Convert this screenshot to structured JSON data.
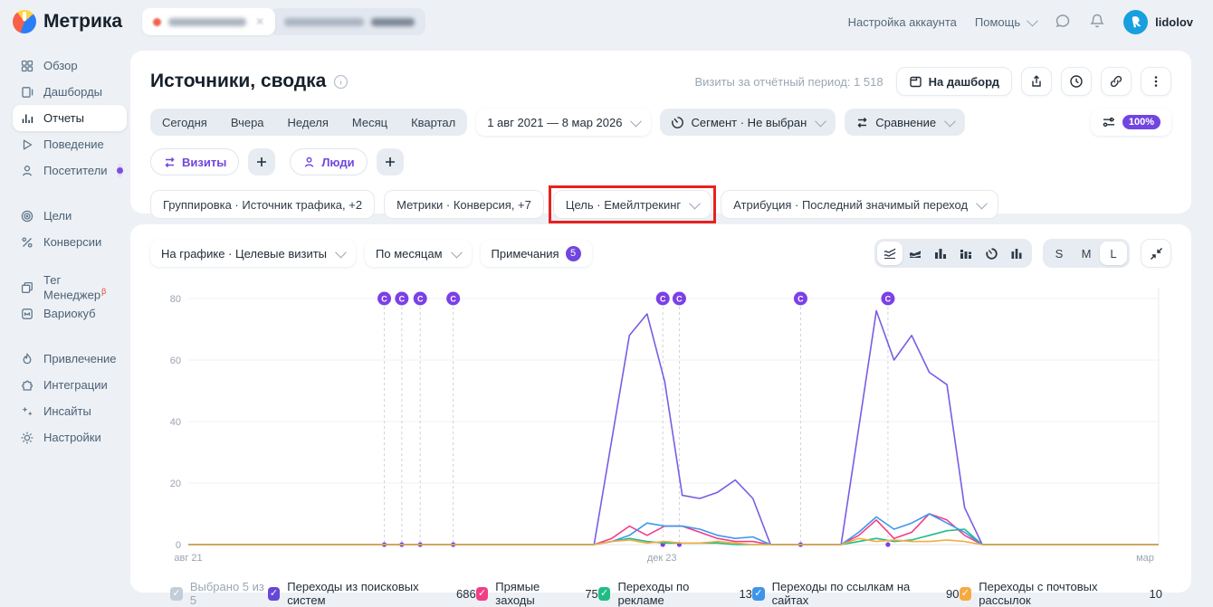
{
  "brand": {
    "name": "Метрика"
  },
  "topbar": {
    "account_settings": "Настройка аккаунта",
    "help": "Помощь",
    "username": "lidolov"
  },
  "sidebar": {
    "items": [
      {
        "label": "Обзор"
      },
      {
        "label": "Дашборды"
      },
      {
        "label": "Отчеты"
      },
      {
        "label": "Поведение"
      },
      {
        "label": "Посетители"
      },
      {
        "label": "Цели"
      },
      {
        "label": "Конверсии"
      },
      {
        "label": "Тег Менеджер",
        "beta": "β"
      },
      {
        "label": "Вариокуб"
      },
      {
        "label": "Привлечение"
      },
      {
        "label": "Интеграции"
      },
      {
        "label": "Инсайты"
      },
      {
        "label": "Настройки"
      }
    ]
  },
  "header": {
    "title": "Источники, сводка",
    "visits_note": "Визиты за отчётный период: 1 518",
    "dashboard_button": "На дашборд"
  },
  "filters": {
    "presets": [
      "Сегодня",
      "Вчера",
      "Неделя",
      "Месяц",
      "Квартал"
    ],
    "date_range": "1 авг 2021 — 8 мар 2026",
    "segment": "Сегмент · Не выбран",
    "compare": "Сравнение",
    "sampling": "100%"
  },
  "metrics_row": {
    "visits": "Визиты",
    "people": "Люди"
  },
  "dropdowns": {
    "grouping": "Группировка · Источник трафика, +2",
    "metrics": "Метрики · Конверсия, +7",
    "goal": "Цель · Емейлтрекинг",
    "attribution": "Атрибуция · Последний значимый переход"
  },
  "chart_controls": {
    "on_chart": "На графике · Целевые визиты",
    "period": "По месяцам",
    "notes": "Примечания",
    "notes_count": "5",
    "sizes": [
      "S",
      "M",
      "L"
    ],
    "active_size": "L"
  },
  "chart_data": {
    "type": "line",
    "title": "Целевые визиты по месяцам",
    "x_unit": "month",
    "x_range": [
      "авг 2021",
      "мар 2026"
    ],
    "xticks": [
      {
        "label": "авг 21",
        "pos": 0.0
      },
      {
        "label": "дек 23",
        "pos": 0.488
      },
      {
        "label": "мар",
        "pos": 0.986
      }
    ],
    "ylim": [
      0,
      80
    ],
    "yticks": [
      0,
      20,
      40,
      60,
      80
    ],
    "grid": true,
    "annotations": {
      "symbol": "C",
      "positions": [
        0.202,
        0.22,
        0.239,
        0.273,
        0.489,
        0.506,
        0.631,
        0.721
      ]
    },
    "series": [
      {
        "name": "Переходы из поисковых систем",
        "color": "#7b5ce2",
        "values": [
          0,
          0,
          0,
          0,
          0,
          0,
          0,
          0,
          0,
          0,
          0,
          0,
          0,
          0,
          0,
          0,
          0,
          0,
          0,
          0,
          0,
          0,
          0,
          0,
          34,
          68,
          75,
          53,
          16,
          15,
          17,
          21,
          15,
          0,
          0,
          0,
          0,
          0,
          38,
          76,
          60,
          68,
          56,
          52,
          12,
          0,
          0,
          0,
          0,
          0,
          0,
          0,
          0,
          0,
          0,
          0
        ]
      },
      {
        "name": "Прямые заходы",
        "color": "#f23d86",
        "values": [
          0,
          0,
          0,
          0,
          0,
          0,
          0,
          0,
          0,
          0,
          0,
          0,
          0,
          0,
          0,
          0,
          0,
          0,
          0,
          0,
          0,
          0,
          0,
          0,
          2,
          6,
          3,
          6,
          6,
          4,
          2,
          1,
          1,
          0,
          0,
          0,
          0,
          0,
          3,
          8,
          2,
          4,
          10,
          8,
          3,
          0,
          0,
          0,
          0,
          0,
          0,
          0,
          0,
          0,
          0,
          0
        ]
      },
      {
        "name": "Переходы по рекламе",
        "color": "#21bd84",
        "values": [
          0,
          0,
          0,
          0,
          0,
          0,
          0,
          0,
          0,
          0,
          0,
          0,
          0,
          0,
          0,
          0,
          0,
          0,
          0,
          0,
          0,
          0,
          0,
          0,
          1,
          2,
          1,
          0.5,
          0.5,
          0.5,
          0.5,
          0,
          0,
          0,
          0,
          0,
          0,
          0,
          1,
          2,
          1,
          1.5,
          3,
          4.5,
          5,
          0,
          0,
          0,
          0,
          0,
          0,
          0,
          0,
          0,
          0,
          0
        ]
      },
      {
        "name": "Переходы по ссылкам на сайтах",
        "color": "#3f97ed",
        "values": [
          0,
          0,
          0,
          0,
          0,
          0,
          0,
          0,
          0,
          0,
          0,
          0,
          0,
          0,
          0,
          0,
          0,
          0,
          0,
          0,
          0,
          0,
          0,
          0,
          1,
          3,
          7,
          6,
          6,
          5,
          3,
          2,
          2.5,
          0,
          0,
          0,
          0,
          0,
          4,
          9,
          5,
          7,
          10,
          7,
          4,
          0,
          0,
          0,
          0,
          0,
          0,
          0,
          0,
          0,
          0,
          0
        ]
      },
      {
        "name": "Переходы с почтовых рассылок",
        "color": "#f5ab42",
        "values": [
          0,
          0,
          0,
          0,
          0,
          0,
          0,
          0,
          0,
          0,
          0,
          0,
          0,
          0,
          0,
          0,
          0,
          0,
          0,
          0,
          0,
          0,
          0,
          0,
          1,
          1.5,
          0.5,
          1,
          0.5,
          0.5,
          1,
          0.5,
          0,
          0,
          0,
          0,
          0,
          0,
          2,
          1,
          1.5,
          1,
          1,
          1.5,
          1,
          0,
          0,
          0,
          0,
          0,
          0,
          0,
          0,
          0,
          0,
          0
        ]
      }
    ]
  },
  "legend": {
    "selected": "Выбрано 5 из 5",
    "selected_color": "#c3cdd8",
    "items": [
      {
        "label": "Переходы из поисковых систем",
        "value": "686",
        "color": "#6647d6"
      },
      {
        "label": "Прямые заходы",
        "value": "75",
        "color": "#f23d86"
      },
      {
        "label": "Переходы по рекламе",
        "value": "13",
        "color": "#1fbd84"
      },
      {
        "label": "Переходы по ссылкам на сайтах",
        "value": "90",
        "color": "#3d94eb"
      },
      {
        "label": "Переходы с почтовых рассылок",
        "value": "10",
        "color": "#f5ab42"
      }
    ]
  }
}
